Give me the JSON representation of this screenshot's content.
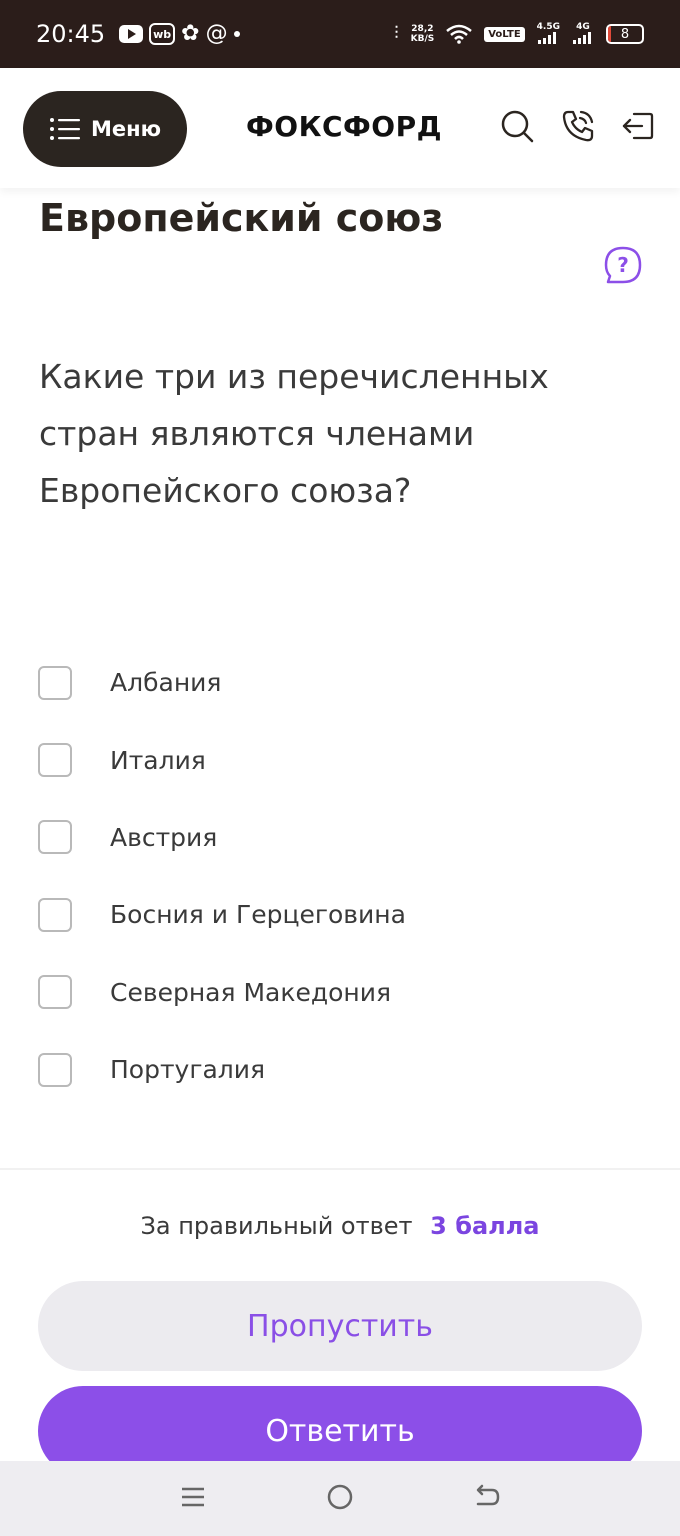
{
  "status_bar": {
    "time": "20:45",
    "net_speed_top": "28,2",
    "net_speed_bottom": "KB/S",
    "volte": "VoLTE",
    "sim1_label": "4.5G",
    "sim2_label": "4G",
    "battery": "8",
    "battery_level": 0.08,
    "icons": [
      "youtube-icon",
      "wb-icon",
      "app-icon",
      "at-icon",
      "dot-icon",
      "vibrate-icon",
      "wifi-icon",
      "signal-icon",
      "battery-icon"
    ]
  },
  "header": {
    "menu_label": "Меню",
    "logo": "ФОКСФОРД",
    "icons": [
      "search-icon",
      "phone-icon",
      "login-icon"
    ]
  },
  "page": {
    "title": "Европейский союз",
    "question": "Какие три из перечисленных стран являются членами Европейского союза?",
    "options": [
      {
        "label": "Албания",
        "checked": false
      },
      {
        "label": "Италия",
        "checked": false
      },
      {
        "label": "Австрия",
        "checked": false
      },
      {
        "label": "Босния и Герцеговина",
        "checked": false
      },
      {
        "label": "Северная Македония",
        "checked": false
      },
      {
        "label": "Португалия",
        "checked": false
      }
    ]
  },
  "footer": {
    "score_text": "За правильный ответ",
    "score_points": "3 балла",
    "skip_label": "Пропустить",
    "answer_label": "Ответить"
  },
  "colors": {
    "accent": "#8c4fe8",
    "header_dark": "#2b2520",
    "status_bar": "#2b1d1a"
  }
}
